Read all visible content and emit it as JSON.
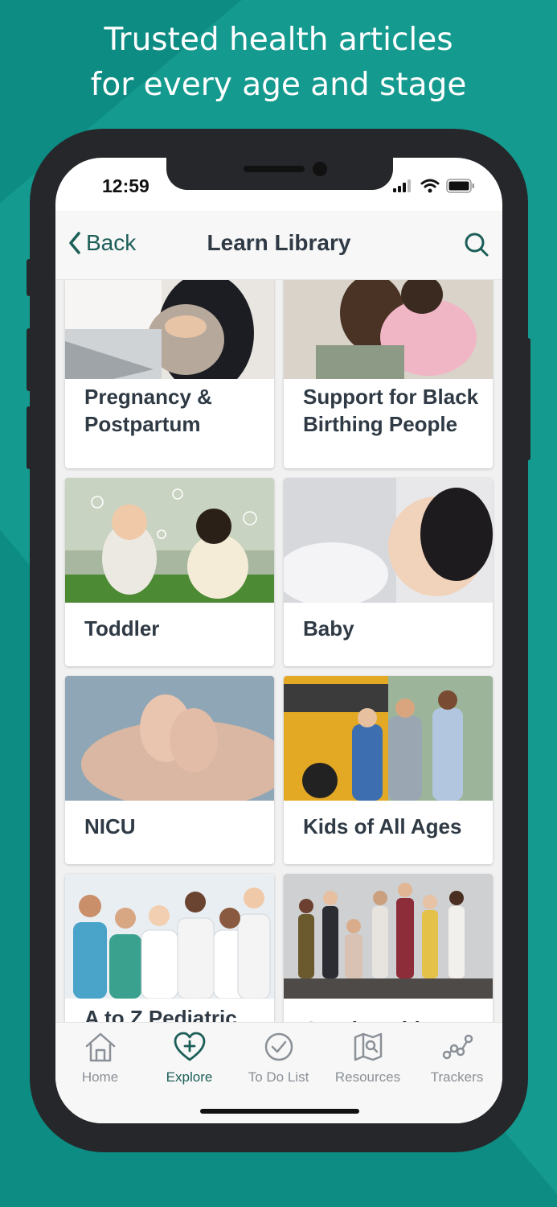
{
  "promo": {
    "headline_line1": "Trusted health articles",
    "headline_line2": "for every age and stage"
  },
  "status_bar": {
    "time": "12:59",
    "icons": [
      "signal-icon",
      "wifi-icon",
      "battery-icon"
    ]
  },
  "nav": {
    "back_label": "Back",
    "title": "Learn Library",
    "search_icon": "search-icon"
  },
  "cards": [
    {
      "label": "Pregnancy & Postpartum",
      "image": "pregnant-woman-laptop-photo"
    },
    {
      "label": "Support for Black Birthing People",
      "image": "mother-holding-baby-photo"
    },
    {
      "label": "Toddler",
      "image": "toddlers-bubbles-photo"
    },
    {
      "label": "Baby",
      "image": "baby-lying-photo"
    },
    {
      "label": "NICU",
      "image": "baby-feet-hands-photo"
    },
    {
      "label": "Kids of All Ages",
      "image": "kids-school-bus-photo"
    },
    {
      "label": "A to Z Pediatric Health",
      "image": "medical-team-photo"
    },
    {
      "label": "Good Health",
      "image": "diverse-group-photo"
    }
  ],
  "tabs": [
    {
      "label": "Home",
      "icon": "home-icon",
      "active": false
    },
    {
      "label": "Explore",
      "icon": "heart-plus-icon",
      "active": true
    },
    {
      "label": "To Do List",
      "icon": "check-circle-icon",
      "active": false
    },
    {
      "label": "Resources",
      "icon": "map-search-icon",
      "active": false
    },
    {
      "label": "Trackers",
      "icon": "trackers-icon",
      "active": false
    }
  ],
  "colors": {
    "background": "#0c8c82",
    "accent": "#1b5e57",
    "inactive_tab": "#8a9097",
    "title_text": "#2f3a45"
  }
}
